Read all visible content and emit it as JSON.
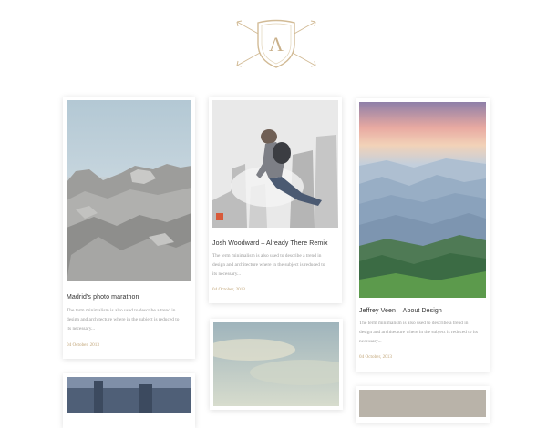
{
  "brand": {
    "logo_letter": "A",
    "accent_color": "#c9b08a"
  },
  "posts": [
    {
      "title": "Madrid's photo marathon",
      "excerpt": "The term minimalism is also used to describe a trend in design and architecture where in the subject is reduced to its necessary...",
      "date": "04 October, 2013",
      "image": "rocky landscape"
    },
    {
      "title": "Josh Woodward – Already There Remix",
      "excerpt": "The term minimalism is also used to describe a trend in design and architecture where in the subject is reduced to its necessary...",
      "date": "04 October, 2013",
      "image": "man jumping over city"
    },
    {
      "title": "Jeffrey Veen – About Design",
      "excerpt": "The term minimalism is also used to describe a trend in design and architecture where in the subject is reduced to its necessary...",
      "date": "04 October, 2013",
      "image": "misty mountains at sunset"
    },
    {
      "image": "cloudy sky"
    },
    {
      "image": "city skyline"
    },
    {
      "image": "landscape"
    }
  ]
}
